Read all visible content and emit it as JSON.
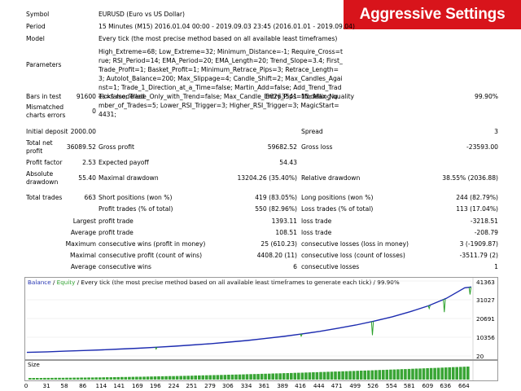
{
  "banner": "Aggressive Settings",
  "header": {
    "symbol_label": "Symbol",
    "symbol_value": "EURUSD (Euro vs US Dollar)",
    "period_label": "Period",
    "period_value": "15 Minutes (M15) 2016.01.04 00:00 - 2019.09.03 23:45 (2016.01.01 - 2019.09.04)",
    "model_label": "Model",
    "model_value": "Every tick (the most precise method based on all available least timeframes)",
    "parameters_label": "Parameters",
    "parameters_value": "High_Extreme=68; Low_Extreme=32; Minimum_Distance=-1; Require_Cross=true; RSI_Period=14; EMA_Period=20; EMA_Length=20; Trend_Slope=3.4; First_Trade_Profit=1; Basket_Profit=1; Minimum_Retrace_Pips=3; Retrace_Length=3; Autolot_Balance=200; Max_Slippage=4; Candle_Shift=2; Max_Candles_Against=1; Trade_1_Direction_at_a_Time=false; Martin_Add=false; Add_Trend_Trades=false; Trade_Only_with_Trend=false; Max_Candle_Entry_Pips=15; Max_Number_of_Trades=5; Lower_RSI_Trigger=3; Higher_RSI_Trigger=3; MagicStart=4431;"
  },
  "stats": {
    "bars_label": "Bars in test",
    "bars_value": "91600",
    "ticks_label": "Ticks modelled",
    "ticks_value": "86263541",
    "quality_label": "Modelling quality",
    "quality_value": "99.90%",
    "mismatch_label_1": "Mismatched",
    "mismatch_label_2": "charts errors",
    "mismatch_value": "0",
    "deposit_label": "Initial deposit",
    "deposit_value": "2000.00",
    "spread_label": "Spread",
    "spread_value": "3",
    "net_label_1": "Total net",
    "net_label_2": "profit",
    "net_value": "36089.52",
    "gross_profit_label": "Gross profit",
    "gross_profit_value": "59682.52",
    "gross_loss_label": "Gross loss",
    "gross_loss_value": "-23593.00",
    "pf_label": "Profit factor",
    "pf_value": "2.53",
    "payoff_label": "Expected payoff",
    "payoff_value": "54.43",
    "absdd_label_1": "Absolute",
    "absdd_label_2": "drawdown",
    "absdd_value": "55.40",
    "maxdd_label": "Maximal drawdown",
    "maxdd_value": "13204.26 (35.40%)",
    "reldd_label": "Relative drawdown",
    "reldd_value": "38.55% (2036.88)",
    "trades_label": "Total trades",
    "trades_value": "663",
    "short_label": "Short positions (won %)",
    "short_value": "419 (83.05%)",
    "long_label": "Long positions (won %)",
    "long_value": "244 (82.79%)",
    "profit_trades_label": "Profit trades (% of total)",
    "profit_trades_value": "550 (82.96%)",
    "loss_trades_label": "Loss trades (% of total)",
    "loss_trades_value": "113 (17.04%)",
    "largest_label": "Largest",
    "largest_profit_label": "profit trade",
    "largest_profit_value": "1393.11",
    "largest_loss_label": "loss trade",
    "largest_loss_value": "-3218.51",
    "average_label": "Average",
    "average_profit_label": "profit trade",
    "average_profit_value": "108.51",
    "average_loss_label": "loss trade",
    "average_loss_value": "-208.79",
    "maximum_label": "Maximum",
    "max_wins_label": "consecutive wins (profit in money)",
    "max_wins_value": "25 (610.23)",
    "max_losses_label": "consecutive losses (loss in money)",
    "max_losses_value": "3 (-1909.87)",
    "maximal_label": "Maximal",
    "maximal_profit_label": "consecutive profit (count of wins)",
    "maximal_profit_value": "4408.20 (11)",
    "maximal_loss_label": "consecutive loss (count of losses)",
    "maximal_loss_value": "-3511.79 (2)",
    "average2_label": "Average",
    "avg_wins_label": "consecutive wins",
    "avg_wins_value": "6",
    "avg_losses_label": "consecutive losses",
    "avg_losses_value": "1"
  },
  "chart_caption": {
    "balance": "Balance",
    "sep1": " / ",
    "equity": "Equity",
    "rest": " / Every tick (the most precise method based on all available least timeframes to generate each tick) / 99.90%"
  },
  "size_label": "Size",
  "chart_data": {
    "type": "line",
    "yticks": [
      "41363",
      "31027",
      "20691",
      "10356",
      "20"
    ],
    "xticks": [
      "0",
      "31",
      "58",
      "86",
      "114",
      "141",
      "169",
      "196",
      "224",
      "251",
      "279",
      "306",
      "334",
      "361",
      "389",
      "416",
      "444",
      "471",
      "499",
      "526",
      "554",
      "581",
      "609",
      "636",
      "664"
    ],
    "xlim": [
      0,
      674
    ],
    "ylim": [
      20,
      41363
    ],
    "balance_x": [
      0,
      31,
      58,
      86,
      114,
      141,
      169,
      196,
      224,
      251,
      279,
      306,
      334,
      361,
      389,
      416,
      444,
      471,
      499,
      526,
      554,
      581,
      609,
      636,
      664,
      674
    ],
    "balance_y": [
      2000,
      2320,
      2650,
      3010,
      3390,
      3820,
      4290,
      4820,
      5420,
      6070,
      6810,
      7640,
      8580,
      9630,
      10790,
      12110,
      13590,
      15240,
      17110,
      19230,
      21630,
      24440,
      27720,
      31790,
      37620,
      38089
    ],
    "equity_dips": [
      {
        "x": 196,
        "y": 3800
      },
      {
        "x": 416,
        "y": 10950
      },
      {
        "x": 524,
        "y": 11500
      },
      {
        "x": 610,
        "y": 26200
      },
      {
        "x": 633,
        "y": 24200
      },
      {
        "x": 672,
        "y": 33900
      }
    ],
    "colors": {
      "balance": "#1c2bb0",
      "equity": "#2aa02a",
      "size": "#39a535"
    }
  }
}
